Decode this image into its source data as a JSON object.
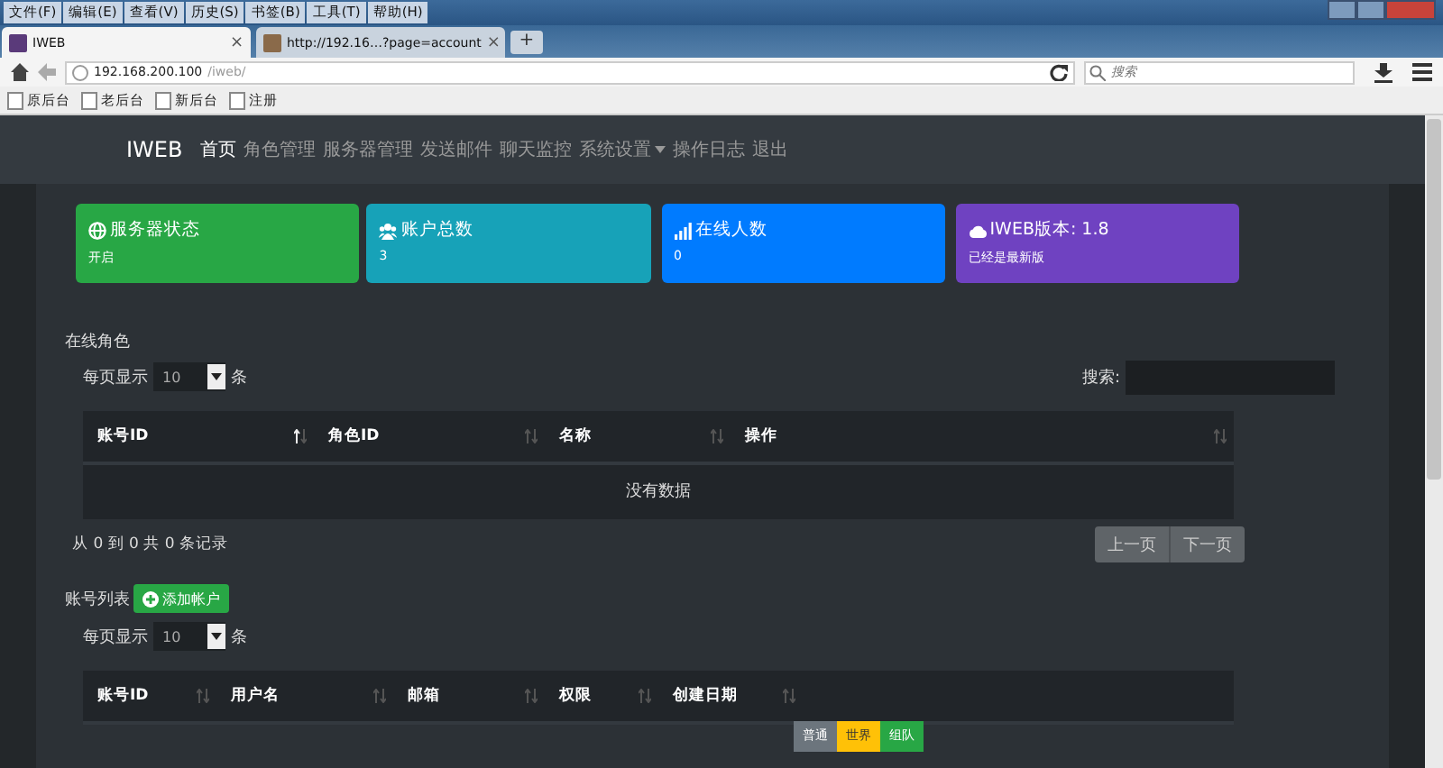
{
  "browser": {
    "menu": [
      "文件(F)",
      "编辑(E)",
      "查看(V)",
      "历史(S)",
      "书签(B)",
      "工具(T)",
      "帮助(H)"
    ],
    "tabs": [
      {
        "label": "IWEB",
        "selected": true,
        "close": "×"
      },
      {
        "label": "http://192.16…?page=account",
        "selected": false,
        "close": "×"
      }
    ],
    "new_tab": "+",
    "address": {
      "host": "192.168.200.100",
      "path": "/iweb/"
    },
    "search": {
      "placeholder": "搜索"
    },
    "bookmarks": [
      "原后台",
      "老后台",
      "新后台",
      "注册"
    ]
  },
  "navbar": {
    "brand": "IWEB",
    "items": [
      {
        "label": "首页",
        "selected": true,
        "dropdown": false
      },
      {
        "label": "角色管理",
        "selected": false,
        "dropdown": false
      },
      {
        "label": "服务器管理",
        "selected": false,
        "dropdown": false
      },
      {
        "label": "发送邮件",
        "selected": false,
        "dropdown": false
      },
      {
        "label": "聊天监控",
        "selected": false,
        "dropdown": false
      },
      {
        "label": "系统设置",
        "selected": false,
        "dropdown": true
      },
      {
        "label": "操作日志",
        "selected": false,
        "dropdown": false
      },
      {
        "label": "退出",
        "selected": false,
        "dropdown": false
      }
    ]
  },
  "cards": [
    {
      "kind": "globe",
      "title": "服务器状态",
      "value": "开启",
      "color": "#28a745"
    },
    {
      "kind": "users",
      "title": "账户总数",
      "value": "3",
      "color": "#17a2b8"
    },
    {
      "kind": "signal",
      "title": "在线人数",
      "value": "0",
      "color": "#007bff"
    },
    {
      "kind": "cloud",
      "title": "IWEB版本: 1.8",
      "value": "已经是最新版",
      "color": "#6f42c1"
    }
  ],
  "online_roles": {
    "title": "在线角色",
    "length_label": "每页显示",
    "length_value": "10",
    "length_unit": "条",
    "search_label": "搜索:",
    "columns": [
      {
        "label": "账号ID",
        "sorted": true
      },
      {
        "label": "角色ID",
        "sorted": false
      },
      {
        "label": "名称",
        "sorted": false
      },
      {
        "label": "操作",
        "sorted": false
      }
    ],
    "empty": "没有数据",
    "info": "从 0 到 0 共 0 条记录",
    "prev": "上一页",
    "next": "下一页"
  },
  "accounts": {
    "title": "账号列表",
    "add_button": "添加帐户",
    "length_label": "每页显示",
    "length_value": "10",
    "length_unit": "条",
    "columns": [
      {
        "label": "账号ID",
        "sorted": false
      },
      {
        "label": "用户名",
        "sorted": false
      },
      {
        "label": "邮箱",
        "sorted": false
      },
      {
        "label": "权限",
        "sorted": false
      },
      {
        "label": "创建日期",
        "sorted": false
      }
    ]
  },
  "chat_channels": [
    {
      "label": "普通",
      "color": "#6c757d"
    },
    {
      "label": "世界",
      "color": "#ffc107"
    },
    {
      "label": "组队",
      "color": "#28a745"
    }
  ]
}
